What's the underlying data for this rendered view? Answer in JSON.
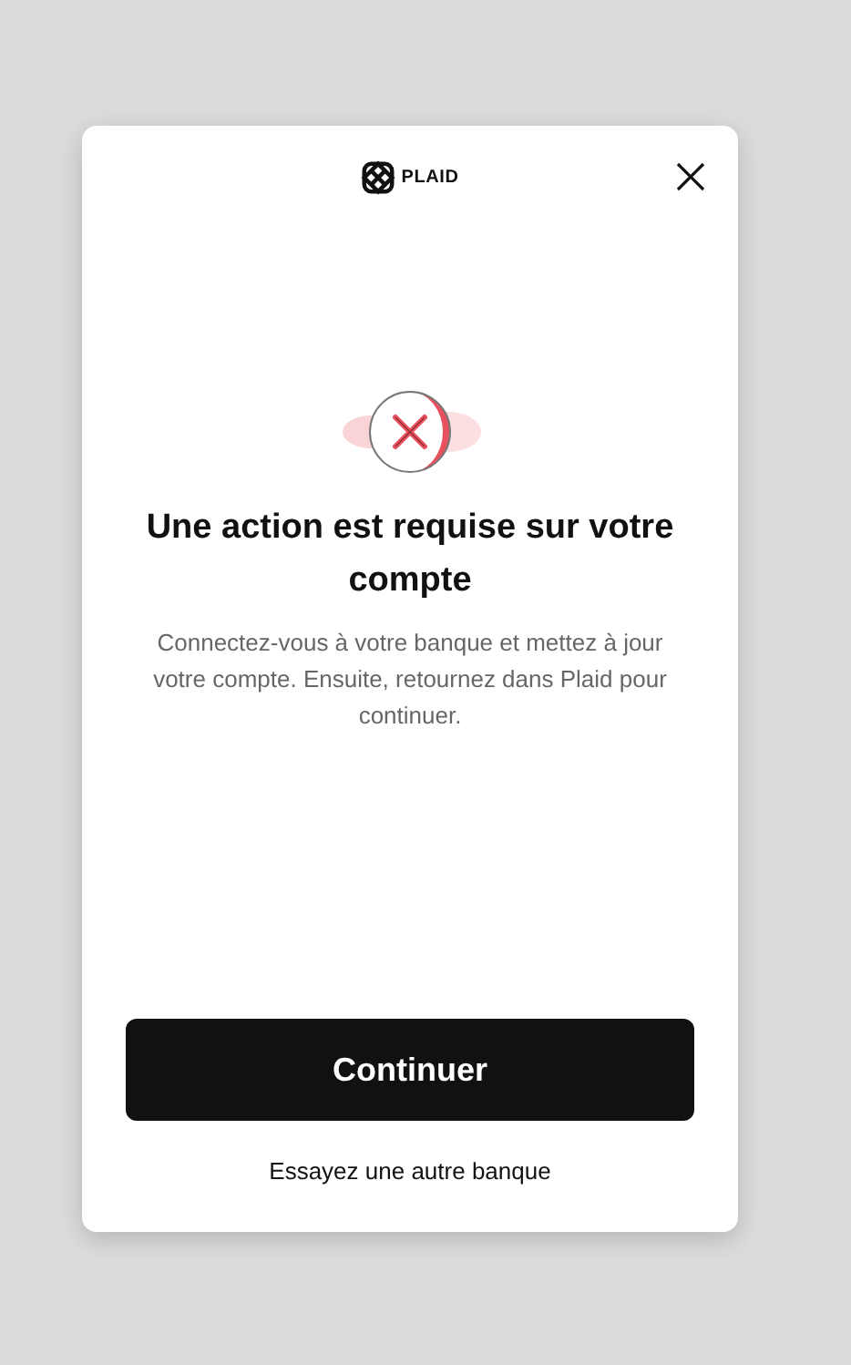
{
  "header": {
    "logo_text": "PLAID"
  },
  "title": "Une action est requise sur votre compte",
  "message": "Connectez-vous à votre banque et mettez à jour votre compte. Ensuite, retournez dans Plaid pour continuer.",
  "primary_button": "Continuer",
  "secondary_link": "Essayez une autre banque"
}
